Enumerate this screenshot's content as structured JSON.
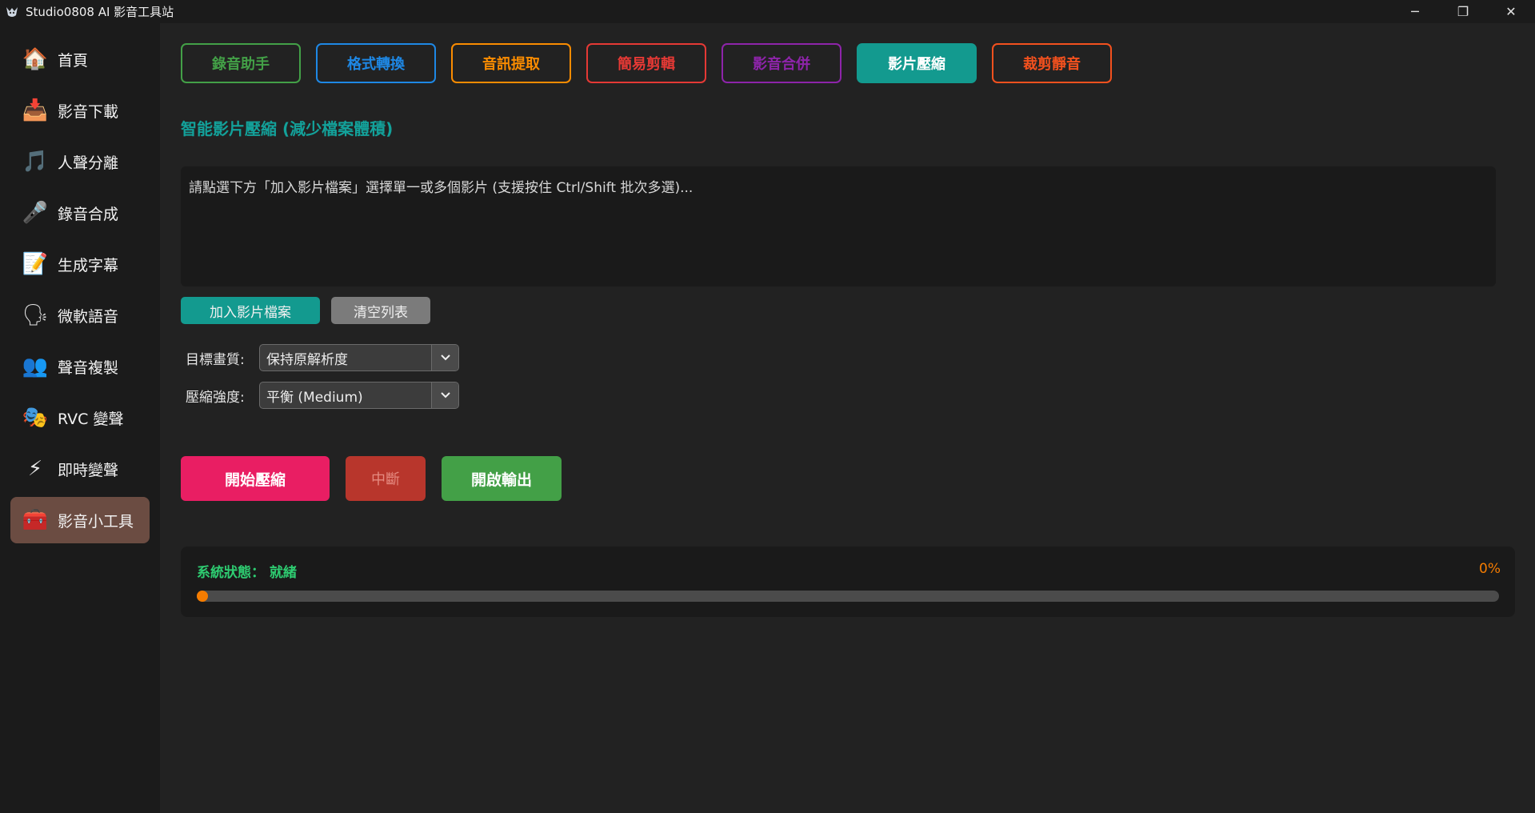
{
  "window": {
    "title": "Studio0808 AI 影音工具站",
    "controls": {
      "minimize": "─",
      "restore": "❐",
      "close": "✕"
    }
  },
  "sidebar": {
    "items": [
      {
        "label": "首頁",
        "icon": "home-icon",
        "glyph": "🏠",
        "active": false
      },
      {
        "label": "影音下載",
        "icon": "download-icon",
        "glyph": "📥",
        "active": false
      },
      {
        "label": "人聲分離",
        "icon": "music-note-icon",
        "glyph": "🎵",
        "active": false
      },
      {
        "label": "錄音合成",
        "icon": "microphone-icon",
        "glyph": "🎤",
        "active": false
      },
      {
        "label": "生成字幕",
        "icon": "memo-icon",
        "glyph": "📝",
        "active": false
      },
      {
        "label": "微軟語音",
        "icon": "speaking-head-icon",
        "glyph": "🗣",
        "active": false
      },
      {
        "label": "聲音複製",
        "icon": "user-clone-icon",
        "glyph": "👥",
        "active": false
      },
      {
        "label": "RVC 變聲",
        "icon": "masks-icon",
        "glyph": "🎭",
        "active": false
      },
      {
        "label": "即時變聲",
        "icon": "lightning-icon",
        "glyph": "⚡",
        "active": false
      },
      {
        "label": "影音小工具",
        "icon": "toolbox-icon",
        "glyph": "🧰",
        "active": true
      }
    ]
  },
  "tabs": [
    {
      "label": "錄音助手",
      "color": "#43a047",
      "active": false
    },
    {
      "label": "格式轉換",
      "color": "#1e88e5",
      "active": false
    },
    {
      "label": "音訊提取",
      "color": "#fb8c00",
      "active": false
    },
    {
      "label": "簡易剪輯",
      "color": "#e53935",
      "active": false
    },
    {
      "label": "影音合併",
      "color": "#8e24aa",
      "active": false
    },
    {
      "label": "影片壓縮",
      "color": "#139a8f",
      "active": true
    },
    {
      "label": "裁剪靜音",
      "color": "#f4511e",
      "active": false
    }
  ],
  "main": {
    "section_title": "智能影片壓縮 (減少檔案體積)",
    "file_list_placeholder": "請點選下方「加入影片檔案」選擇單一或多個影片 (支援按住 Ctrl/Shift 批次多選)...",
    "add_button": "加入影片檔案",
    "clear_button": "清空列表",
    "quality_label": "目標畫質:",
    "quality_value": "保持原解析度",
    "strength_label": "壓縮強度:",
    "strength_value": "平衡 (Medium)",
    "start_button": "開始壓縮",
    "stop_button": "中斷",
    "open_output_button": "開啟輸出"
  },
  "status": {
    "text": "系統狀態： 就緒",
    "percent_label": "0%",
    "progress": 0
  },
  "colors": {
    "accent": "#139a8f",
    "status_ok": "#2ecc71",
    "progress": "#f57c00"
  }
}
